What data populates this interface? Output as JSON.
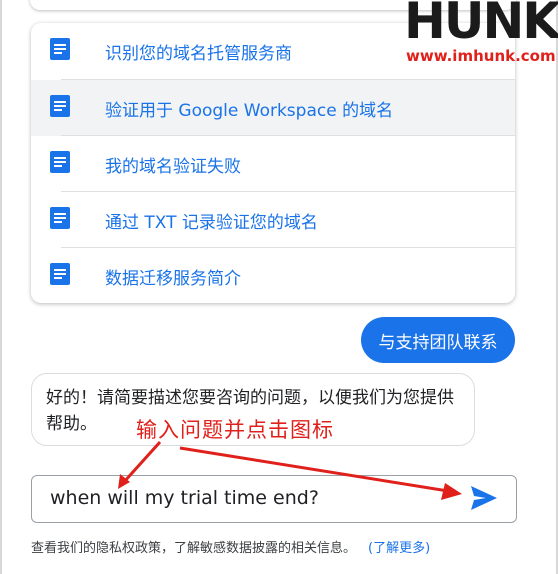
{
  "help_list": {
    "items": [
      {
        "label": "识别您的域名托管服务商",
        "icon": "document-icon",
        "active": false
      },
      {
        "label": "验证用于 Google Workspace 的域名",
        "icon": "document-icon",
        "active": true
      },
      {
        "label": "我的域名验证失败",
        "icon": "document-icon",
        "active": false
      },
      {
        "label": "通过 TXT 记录验证您的域名",
        "icon": "document-icon",
        "active": false
      },
      {
        "label": "数据迁移服务简介",
        "icon": "document-icon",
        "active": false
      }
    ]
  },
  "chat": {
    "contact_button": "与支持团队联系",
    "bot_message": "好的！请简要描述您要咨询的问题，以便我们为您提供帮助。",
    "input_value": "when will my trial time end?",
    "send_icon": "send-icon"
  },
  "footer": {
    "privacy_text": "查看我们的隐私权政策，了解敏感数据披露的相关信息。",
    "learn_more": "(了解更多)"
  },
  "annotation": {
    "text": "输入问题并点击图标"
  },
  "watermark": {
    "logo": "HUNK",
    "url": "www.imhunk.com"
  },
  "colors": {
    "accent": "#1a73e8",
    "annotation_red": "#e0201b",
    "active_row": "#f1f3f4"
  }
}
